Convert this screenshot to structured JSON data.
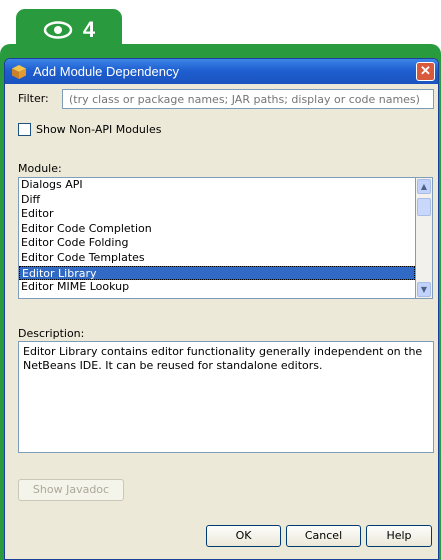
{
  "badge": {
    "icon": "eye-icon",
    "number": "4"
  },
  "dialog": {
    "title": "Add Module Dependency",
    "filter": {
      "label": "Filter:",
      "placeholder": "(try class or package names; JAR paths; display or code names)"
    },
    "show_non_api": {
      "label": "Show Non-API Modules",
      "checked": false
    },
    "module": {
      "label": "Module:",
      "items": [
        "Dialogs API",
        "Diff",
        "Editor",
        "Editor Code Completion",
        "Editor Code Folding",
        "Editor Code Templates",
        "Editor Library",
        "Editor MIME Lookup"
      ],
      "selected": "Editor Library"
    },
    "description": {
      "label": "Description:",
      "text": "Editor Library contains editor functionality generally independent on the NetBeans IDE. It can be reused for standalone editors."
    },
    "buttons": {
      "javadoc": "Show Javadoc",
      "ok": "OK",
      "cancel": "Cancel",
      "help": "Help"
    }
  }
}
